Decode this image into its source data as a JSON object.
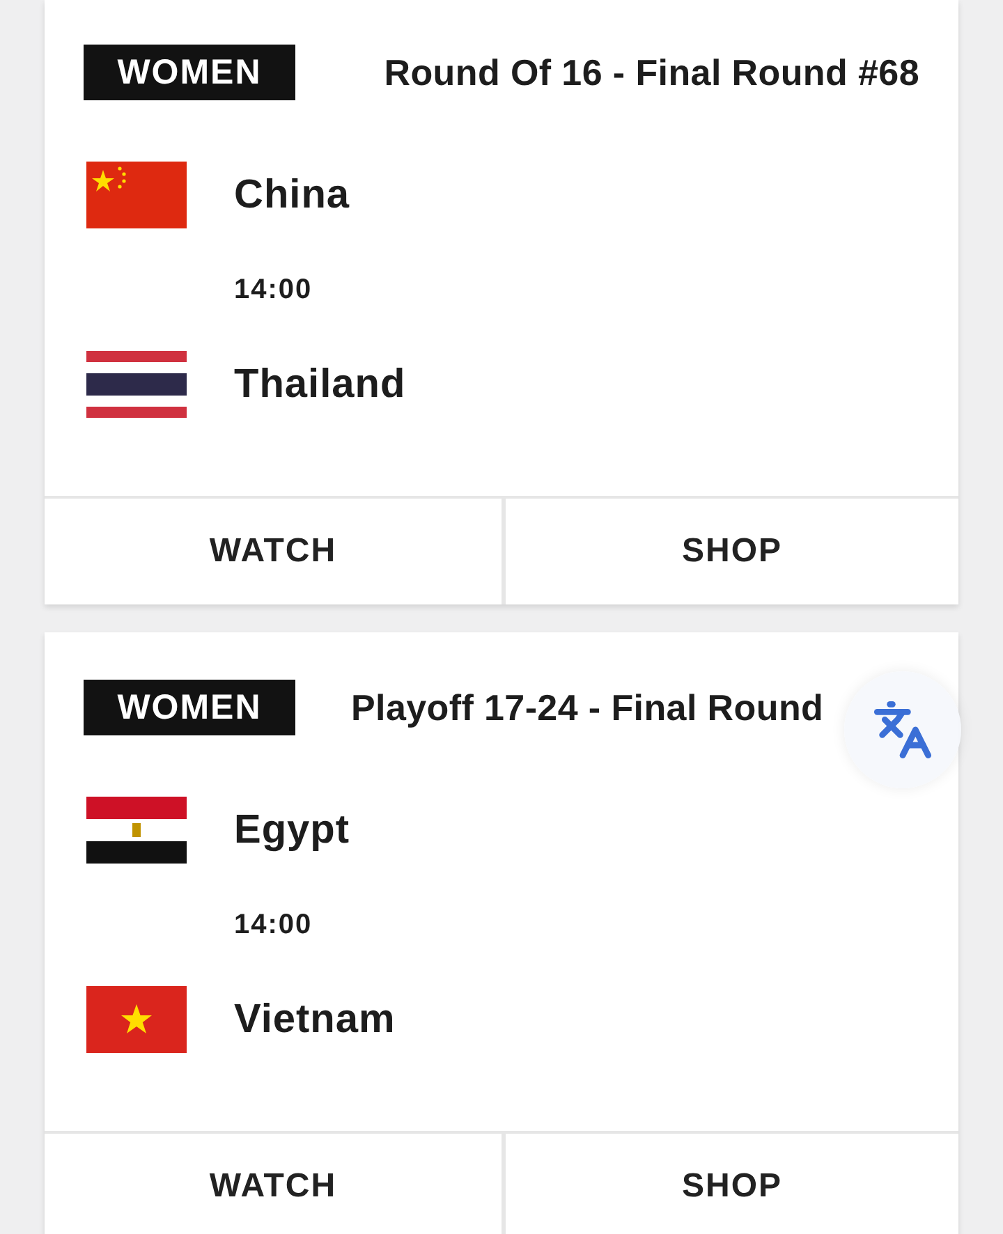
{
  "matches": [
    {
      "tag": "WOMEN",
      "title": "Round Of 16 - Final Round #68",
      "teams": [
        {
          "name": "China"
        },
        {
          "name": "Thailand"
        }
      ],
      "time": "14:00",
      "buttons": [
        "WATCH",
        "SHOP"
      ]
    },
    {
      "tag": "WOMEN",
      "title": "Playoff 17-24 - Final Round",
      "teams": [
        {
          "name": "Egypt"
        },
        {
          "name": "Vietnam"
        }
      ],
      "time": "14:00",
      "buttons": [
        "WATCH",
        "SHOP"
      ],
      "translate_button": true
    }
  ]
}
